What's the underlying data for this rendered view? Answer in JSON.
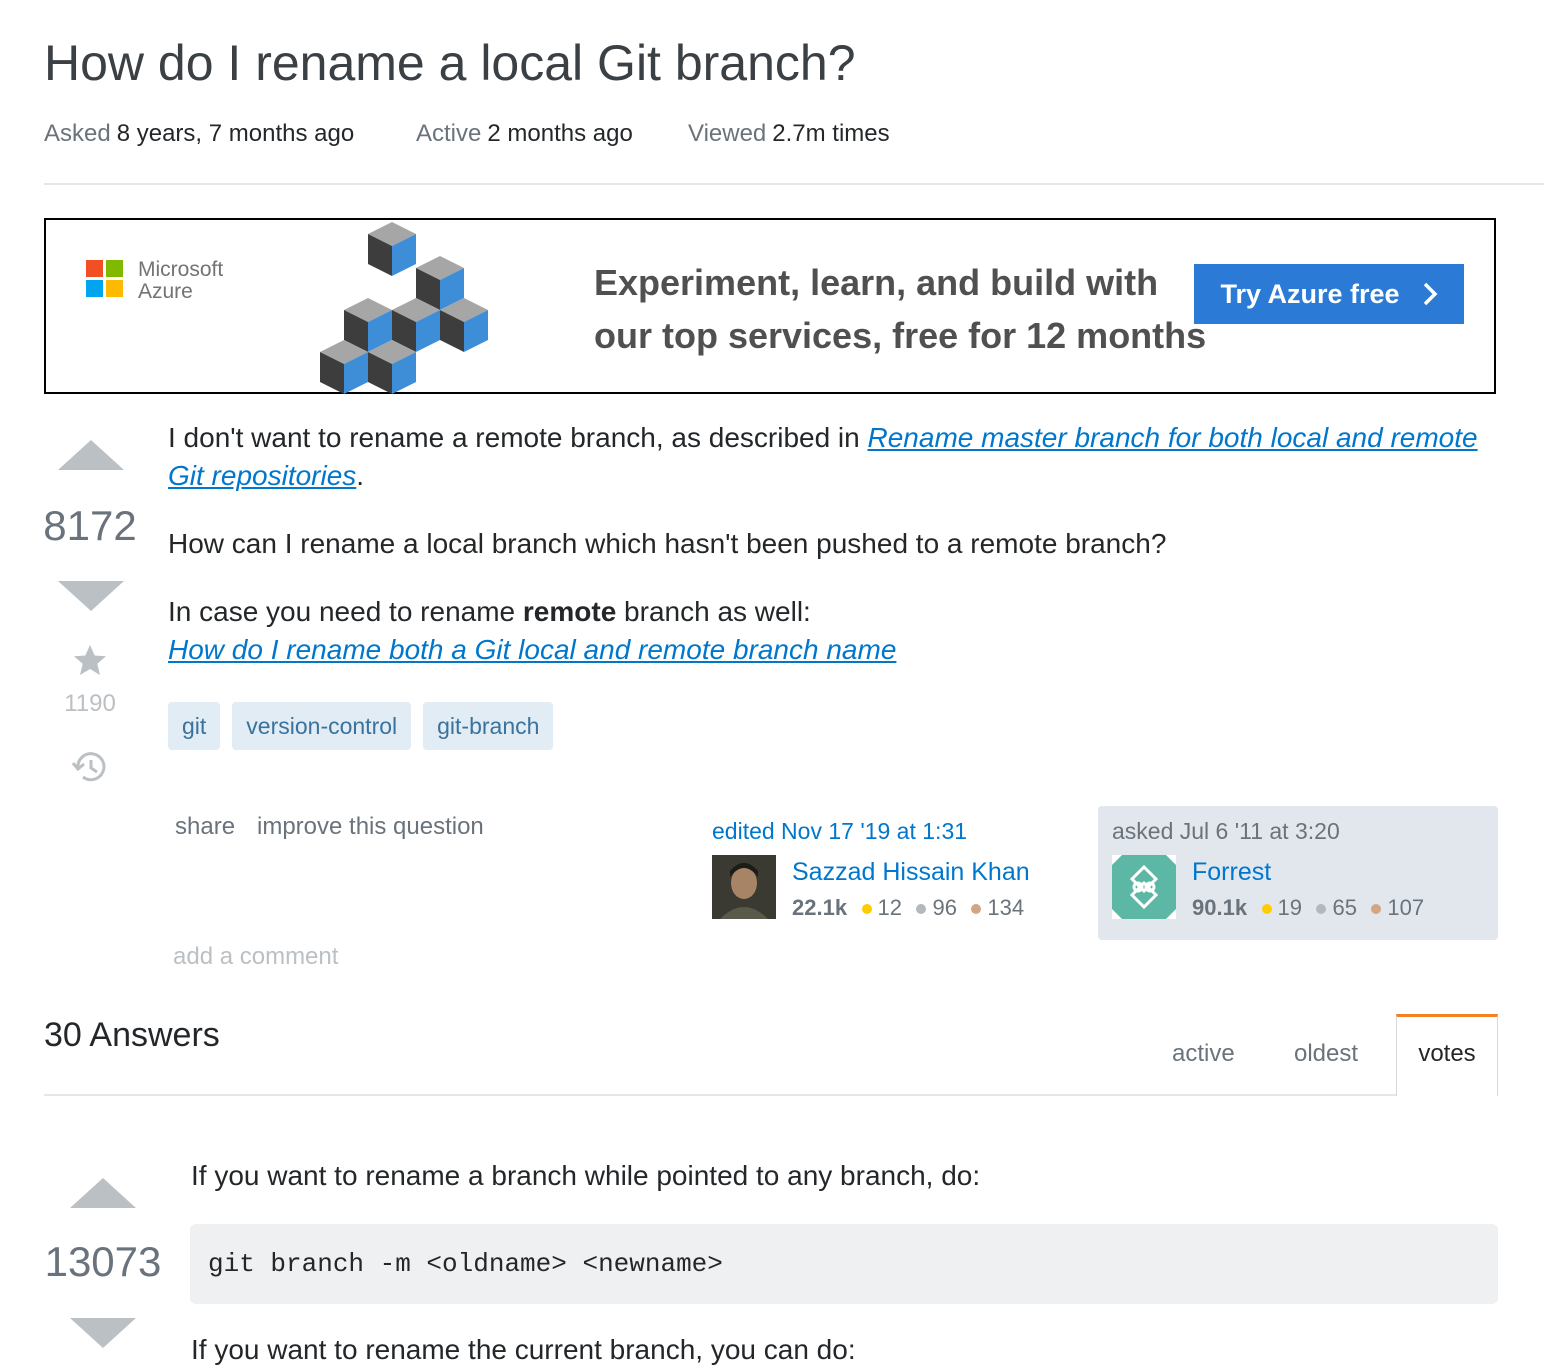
{
  "question": {
    "title": "How do I rename a local Git branch?",
    "meta": {
      "asked_label": "Asked",
      "asked_value": "8 years, 7 months ago",
      "active_label": "Active",
      "active_value": "2 months ago",
      "viewed_label": "Viewed",
      "viewed_value": "2.7m times"
    },
    "votes": "8172",
    "favorites": "1190",
    "body": {
      "p1_text": "I don't want to rename a remote branch, as described in ",
      "p1_link": "Rename master branch for both local and remote Git repositories",
      "p1_end": ".",
      "p2": "How can I rename a local branch which hasn't been pushed to a remote branch?",
      "p3_text": "In case you need to rename ",
      "p3_bold": "remote",
      "p3_end": " branch as well:",
      "p3_link": "How do I rename both a Git local and remote branch name"
    },
    "tags": [
      "git",
      "version-control",
      "git-branch"
    ],
    "actions": {
      "share": "share",
      "improve": "improve this question",
      "add_comment": "add a comment"
    },
    "editor": {
      "action": "edited Nov 17 '19 at 1:31",
      "name": "Sazzad Hissain Khan",
      "rep": "22.1k",
      "gold": "12",
      "silver": "96",
      "bronze": "134"
    },
    "owner": {
      "action": "asked Jul 6 '11 at 3:20",
      "name": "Forrest",
      "rep": "90.1k",
      "gold": "19",
      "silver": "65",
      "bronze": "107"
    }
  },
  "ad": {
    "brand_line1": "Microsoft",
    "brand_line2": "Azure",
    "headline_line1": "Experiment, learn, and build with",
    "headline_line2": "our top services, free for 12 months",
    "cta": "Try Azure free"
  },
  "answers": {
    "count_label": "30 Answers",
    "tabs": [
      "active",
      "oldest",
      "votes"
    ],
    "active_tab": "votes",
    "first": {
      "votes": "13073",
      "p1": "If you want to rename a branch while pointed to any branch, do:",
      "code": "git branch -m <oldname> <newname>",
      "p2": "If you want to rename the current branch, you can do:"
    }
  },
  "colors": {
    "link": "#0077cc",
    "tag_bg": "#e1ecf4",
    "tag_text": "#39739d",
    "owner_bg": "#e1e7ed",
    "cta_bg": "#2b7bd6",
    "active_tab_border": "#f48024"
  }
}
